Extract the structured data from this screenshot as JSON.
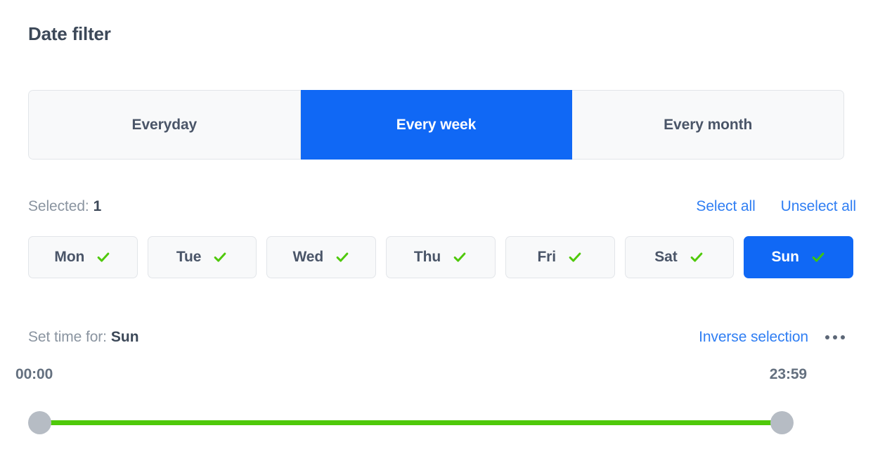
{
  "header": {
    "title": "Date filter"
  },
  "frequency_tabs": [
    {
      "label": "Everyday",
      "active": false
    },
    {
      "label": "Every week",
      "active": true
    },
    {
      "label": "Every month",
      "active": false
    }
  ],
  "selection": {
    "label": "Selected:",
    "count": "1",
    "select_all": "Select all",
    "unselect_all": "Unselect all"
  },
  "days": [
    {
      "label": "Mon",
      "checked": true,
      "selected": false
    },
    {
      "label": "Tue",
      "checked": true,
      "selected": false
    },
    {
      "label": "Wed",
      "checked": true,
      "selected": false
    },
    {
      "label": "Thu",
      "checked": true,
      "selected": false
    },
    {
      "label": "Fri",
      "checked": true,
      "selected": false
    },
    {
      "label": "Sat",
      "checked": true,
      "selected": false
    },
    {
      "label": "Sun",
      "checked": true,
      "selected": true
    }
  ],
  "set_time": {
    "label": "Set time for:",
    "value": "Sun",
    "inverse_selection": "Inverse selection",
    "more_icon": "ellipsis-icon"
  },
  "time_range": {
    "start": "00:00",
    "end": "23:59"
  },
  "icons": {
    "check": "check-icon"
  },
  "colors": {
    "accent_blue": "#1068f5",
    "link_blue": "#2f7ef3",
    "check_green": "#4fc90a",
    "track_green": "#4fc90a",
    "handle_gray": "#b6bcc4",
    "chip_bg": "#f8f9fa",
    "chip_border": "#e2e5e9",
    "text_dark": "#3c4858",
    "text_muted": "#8a94a0"
  }
}
